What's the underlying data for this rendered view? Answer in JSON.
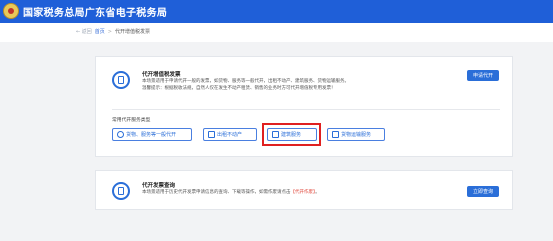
{
  "header": {
    "site_title": "国家税务总局广东省电子税务局"
  },
  "breadcrumb": {
    "back": "← 返回",
    "home": "首页",
    "sep": ">",
    "current": "代开增值税发票"
  },
  "issue_card": {
    "title": "代开增值税发票",
    "desc_line1": "本场景适用于申请代开一般的发票，如货物、服务等一般代开，出租不动产、建筑服务、货物运输服务。",
    "desc_line2": "温馨提示：根据税收法规，自然人仅在发生不动产租赁、销售的业务时方可代开增值税专用发票！",
    "button": "申请代开",
    "section_label": "常用代开服务类型",
    "options": [
      {
        "label": "货物、服务等一般代开",
        "icon": "goods-icon"
      },
      {
        "label": "出租不动产",
        "icon": "house-icon"
      },
      {
        "label": "建筑服务",
        "icon": "building-icon"
      },
      {
        "label": "货物运输服务",
        "icon": "truck-icon"
      }
    ]
  },
  "query_card": {
    "title": "代开发票查询",
    "desc_prefix": "本场景适用于历史代开发票申请信息的查询、下载等操作，如需作废请点击",
    "desc_link": "【代开作废】",
    "desc_suffix": "。",
    "button": "立即查询"
  },
  "colors": {
    "brand": "#1f5fd8",
    "primary": "#2a6ed8",
    "highlight": "#e02020"
  }
}
